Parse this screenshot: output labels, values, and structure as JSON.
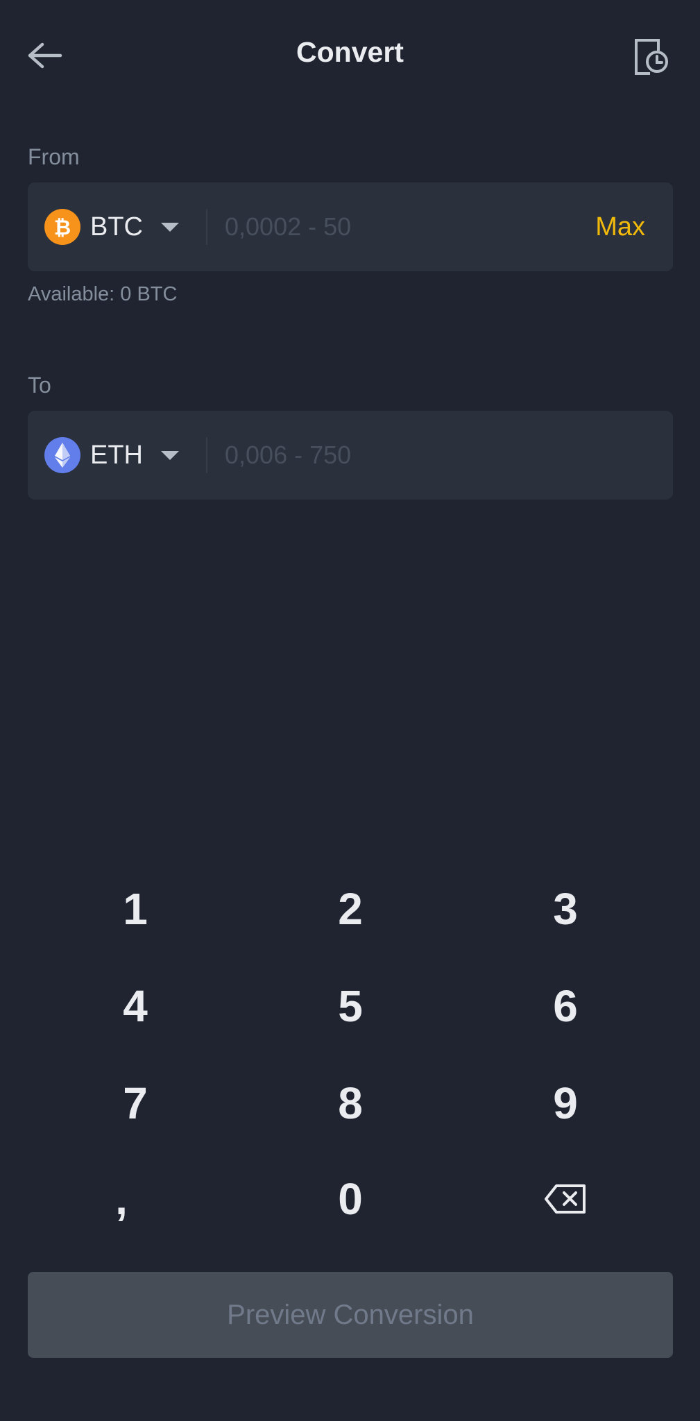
{
  "header": {
    "title": "Convert",
    "back_icon": "arrow-left-icon",
    "history_icon": "order-history-icon"
  },
  "from": {
    "label": "From",
    "coin": "BTC",
    "coin_icon": "bitcoin-icon",
    "coin_color": "#f7931a",
    "placeholder": "0,0002 - 50",
    "max_label": "Max",
    "available": "Available: 0 BTC"
  },
  "to": {
    "label": "To",
    "coin": "ETH",
    "coin_icon": "ethereum-icon",
    "coin_color": "#627eea",
    "placeholder": "0,006 - 750"
  },
  "keypad": {
    "keys": [
      "1",
      "2",
      "3",
      "4",
      "5",
      "6",
      "7",
      "8",
      "9",
      ",",
      "0"
    ],
    "backspace_icon": "backspace-icon"
  },
  "preview_button": {
    "label": "Preview Conversion"
  },
  "colors": {
    "background": "#1f2430",
    "field": "#2a303c",
    "accent": "#f0b90b",
    "muted_text": "#848e9c",
    "disabled_button": "#474d57"
  }
}
